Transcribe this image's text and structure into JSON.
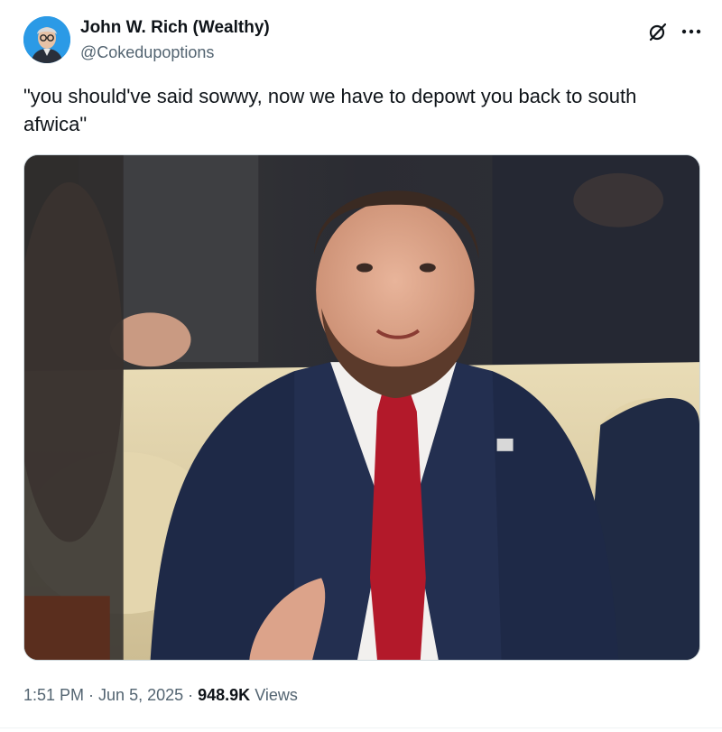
{
  "author": {
    "display_name": "John W. Rich (Wealthy)",
    "handle": "@Cokedupoptions",
    "avatar_icon": "avatar-portrait"
  },
  "header_actions": {
    "grok_icon": "grok-icon",
    "more_icon": "more-icon"
  },
  "tweet": {
    "text": "\"you should've said sowwy, now we have to depowt you back to south afwica\""
  },
  "media": {
    "kind": "photo"
  },
  "meta": {
    "time": "1:51 PM",
    "separator": "·",
    "date": "Jun 5, 2025",
    "views_count": "948.9K",
    "views_label": "Views"
  },
  "colors": {
    "text_primary": "#0f1419",
    "text_secondary": "#536471",
    "border": "#cfd9de",
    "avatar_bg": "#2b9ae6"
  }
}
